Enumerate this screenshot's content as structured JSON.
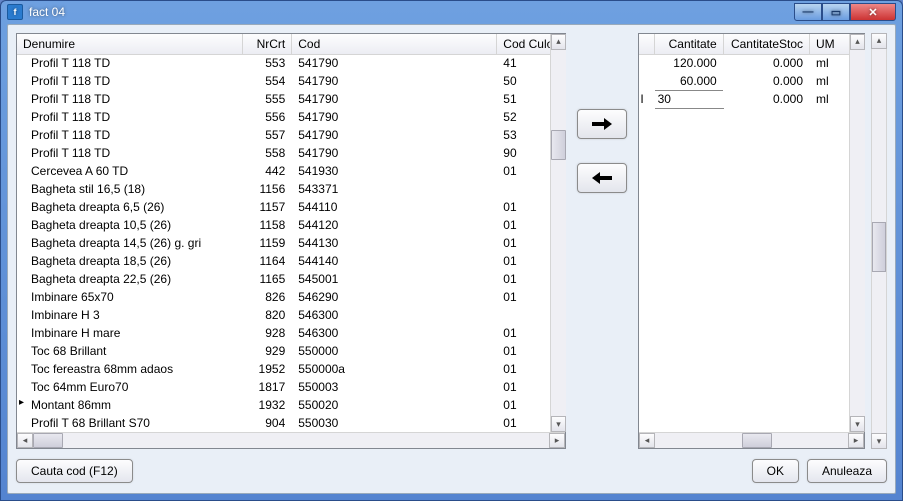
{
  "window": {
    "title": "fact 04"
  },
  "left_grid": {
    "headers": [
      "Denumire",
      "NrCrt",
      "Cod",
      "Cod Culoare"
    ],
    "current_row_index": 20,
    "rows": [
      {
        "denumire": "Profil T 118 TD",
        "nrcrt": 553,
        "cod": "541790",
        "culoare": "41"
      },
      {
        "denumire": "Profil T 118 TD",
        "nrcrt": 554,
        "cod": "541790",
        "culoare": "50"
      },
      {
        "denumire": "Profil T 118 TD",
        "nrcrt": 555,
        "cod": "541790",
        "culoare": "51"
      },
      {
        "denumire": "Profil T 118 TD",
        "nrcrt": 556,
        "cod": "541790",
        "culoare": "52"
      },
      {
        "denumire": "Profil T 118 TD",
        "nrcrt": 557,
        "cod": "541790",
        "culoare": "53"
      },
      {
        "denumire": "Profil T 118 TD",
        "nrcrt": 558,
        "cod": "541790",
        "culoare": "90"
      },
      {
        "denumire": "Cercevea A 60 TD",
        "nrcrt": 442,
        "cod": "541930",
        "culoare": "01"
      },
      {
        "denumire": "Bagheta stil 16,5 (18)",
        "nrcrt": 1156,
        "cod": "543371",
        "culoare": ""
      },
      {
        "denumire": "Bagheta dreapta 6,5 (26)",
        "nrcrt": 1157,
        "cod": "544110",
        "culoare": "01"
      },
      {
        "denumire": "Bagheta dreapta 10,5 (26)",
        "nrcrt": 1158,
        "cod": "544120",
        "culoare": "01"
      },
      {
        "denumire": "Bagheta dreapta 14,5 (26) g. gri",
        "nrcrt": 1159,
        "cod": "544130",
        "culoare": "01"
      },
      {
        "denumire": "Bagheta dreapta 18,5 (26)",
        "nrcrt": 1164,
        "cod": "544140",
        "culoare": "01"
      },
      {
        "denumire": "Bagheta dreapta 22,5 (26)",
        "nrcrt": 1165,
        "cod": "545001",
        "culoare": "01"
      },
      {
        "denumire": "Imbinare 65x70",
        "nrcrt": 826,
        "cod": "546290",
        "culoare": "01"
      },
      {
        "denumire": "Imbinare H 3",
        "nrcrt": 820,
        "cod": "546300",
        "culoare": ""
      },
      {
        "denumire": "Imbinare H mare",
        "nrcrt": 928,
        "cod": "546300",
        "culoare": "01"
      },
      {
        "denumire": "Toc 68 Brillant",
        "nrcrt": 929,
        "cod": "550000",
        "culoare": "01"
      },
      {
        "denumire": "Toc fereastra 68mm adaos",
        "nrcrt": 1952,
        "cod": "550000a",
        "culoare": "01"
      },
      {
        "denumire": "Toc 64mm Euro70",
        "nrcrt": 1817,
        "cod": "550003",
        "culoare": "01"
      },
      {
        "denumire": "Montant 86mm",
        "nrcrt": 1932,
        "cod": "550020",
        "culoare": "01"
      },
      {
        "denumire": "Profil T 68 Brillant S70",
        "nrcrt": 904,
        "cod": "550030",
        "culoare": "01"
      }
    ]
  },
  "right_grid": {
    "headers": [
      "Cantitate",
      "CantitateStoc",
      "UM"
    ],
    "editing_row_index": 2,
    "rows": [
      {
        "cantitate": "120.000",
        "stoc": "0.000",
        "um": "ml"
      },
      {
        "cantitate": "60.000",
        "stoc": "0.000",
        "um": "ml"
      },
      {
        "cantitate": "30",
        "stoc": "0.000",
        "um": "ml"
      }
    ]
  },
  "buttons": {
    "search": "Cauta cod (F12)",
    "ok": "OK",
    "cancel": "Anuleaza"
  }
}
